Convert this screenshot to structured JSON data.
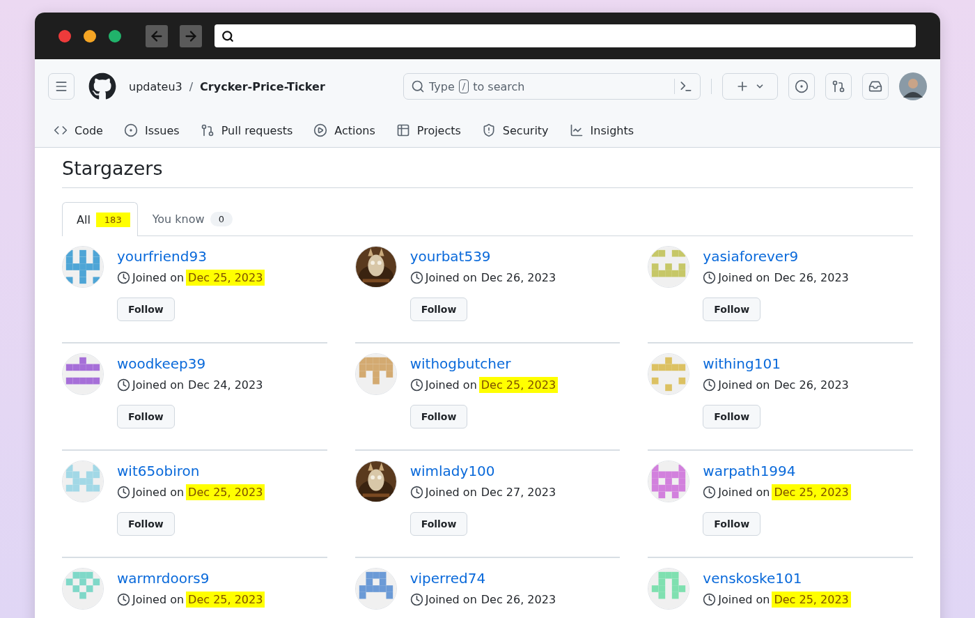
{
  "repo": {
    "owner": "updateu3",
    "separator": "/",
    "name": "Crycker-Price-Ticker"
  },
  "search": {
    "prefix": "Type",
    "key": "/",
    "suffix": "to search"
  },
  "nav": [
    {
      "kind": "code",
      "label": "Code"
    },
    {
      "kind": "issues",
      "label": "Issues"
    },
    {
      "kind": "pulls",
      "label": "Pull requests"
    },
    {
      "kind": "actions",
      "label": "Actions"
    },
    {
      "kind": "projects",
      "label": "Projects"
    },
    {
      "kind": "security",
      "label": "Security"
    },
    {
      "kind": "insights",
      "label": "Insights"
    }
  ],
  "page_title": "Stargazers",
  "tabs": [
    {
      "label": "All",
      "count": "183",
      "selected": true,
      "highlighted": true
    },
    {
      "label": "You know",
      "count": "0",
      "selected": false,
      "highlighted": false
    }
  ],
  "users": [
    {
      "name": "yourfriend93",
      "joined_prefix": "Joined on",
      "date": "Dec 25, 2023",
      "highlighted": true,
      "button": "Follow",
      "avatar": {
        "kind": "identicon",
        "color": "#4ea5d6"
      }
    },
    {
      "name": "yourbat539",
      "joined_prefix": "Joined on",
      "date": "Dec 26, 2023",
      "highlighted": false,
      "button": "Follow"
    },
    {
      "name": "yasiaforever9",
      "joined_prefix": "Joined on",
      "date": "Dec 26, 2023",
      "highlighted": false,
      "button": "Follow",
      "avatar": {
        "kind": "identicon",
        "color": "#c6c767"
      }
    },
    {
      "name": "woodkeep39",
      "joined_prefix": "Joined on",
      "date": "Dec 24, 2023",
      "highlighted": false,
      "button": "Follow",
      "avatar": {
        "kind": "identicon",
        "color": "#a66fd8"
      }
    },
    {
      "name": "withogbutcher",
      "joined_prefix": "Joined on",
      "date": "Dec 25, 2023",
      "highlighted": true,
      "button": "Follow",
      "avatar": {
        "kind": "identicon",
        "color": "#d3aa71"
      }
    },
    {
      "name": "withing101",
      "joined_prefix": "Joined on",
      "date": "Dec 26, 2023",
      "highlighted": false,
      "button": "Follow",
      "avatar": {
        "kind": "identicon",
        "color": "#dcc162"
      }
    },
    {
      "name": "wit65obiron",
      "joined_prefix": "Joined on",
      "date": "Dec 25, 2023",
      "highlighted": true,
      "button": "Follow",
      "avatar": {
        "kind": "identicon",
        "color": "#a2d8e6"
      }
    },
    {
      "name": "wimlady100",
      "joined_prefix": "Joined on",
      "date": "Dec 27, 2023",
      "highlighted": false,
      "button": "Follow"
    },
    {
      "name": "warpath1994",
      "joined_prefix": "Joined on",
      "date": "Dec 25, 2023",
      "highlighted": true,
      "button": "Follow",
      "avatar": {
        "kind": "identicon",
        "color": "#d280dd"
      }
    },
    {
      "name": "warmrdoors9",
      "joined_prefix": "Joined on",
      "date": "Dec 25, 2023",
      "highlighted": true,
      "avatar": {
        "kind": "identicon",
        "color": "#7fd8c8"
      }
    },
    {
      "name": "viperred74",
      "joined_prefix": "Joined on",
      "date": "Dec 26, 2023",
      "highlighted": false,
      "avatar": {
        "kind": "identicon",
        "color": "#6b9ad6"
      }
    },
    {
      "name": "venskoske101",
      "joined_prefix": "Joined on",
      "date": "Dec 25, 2023",
      "highlighted": true,
      "avatar": {
        "kind": "identicon",
        "color": "#7fe0b0"
      }
    }
  ]
}
